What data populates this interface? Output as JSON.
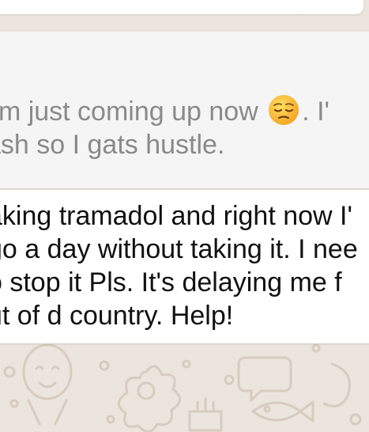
{
  "chat": {
    "wallpaper_color": "#ece5dd",
    "doodle_color": "#d8cfc3"
  },
  "quoted_message": {
    "line1_before_emoji": "I'm just coming up now",
    "emoji": "pensive-face",
    "line1_after_emoji": ". I'",
    "line2": "ash so I gats hustle."
  },
  "message": {
    "lines": [
      "aking tramadol and right now I'",
      "go a day without taking it. I nee",
      "o stop it Pls. It's delaying me f",
      "ut of d country. Help!"
    ]
  }
}
